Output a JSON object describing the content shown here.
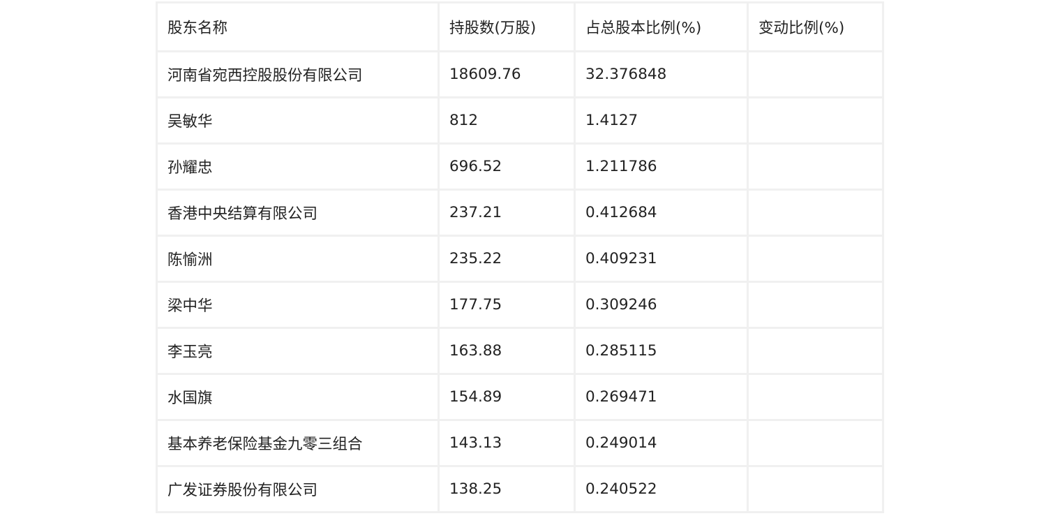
{
  "table": {
    "columns": [
      "股东名称",
      "持股数(万股)",
      "占总股本比例(%)",
      "变动比例(%)"
    ],
    "rows": [
      [
        "河南省宛西控股股份有限公司",
        "18609.76",
        "32.376848",
        ""
      ],
      [
        "吴敏华",
        "812",
        "1.4127",
        ""
      ],
      [
        "孙耀忠",
        "696.52",
        "1.211786",
        ""
      ],
      [
        "香港中央结算有限公司",
        "237.21",
        "0.412684",
        ""
      ],
      [
        "陈愉洲",
        "235.22",
        "0.409231",
        ""
      ],
      [
        "梁中华",
        "177.75",
        "0.309246",
        ""
      ],
      [
        "李玉亮",
        "163.88",
        "0.285115",
        ""
      ],
      [
        "水国旗",
        "154.89",
        "0.269471",
        ""
      ],
      [
        "基本养老保险基金九零三组合",
        "143.13",
        "0.249014",
        ""
      ],
      [
        "广发证券股份有限公司",
        "138.25",
        "0.240522",
        ""
      ]
    ]
  }
}
